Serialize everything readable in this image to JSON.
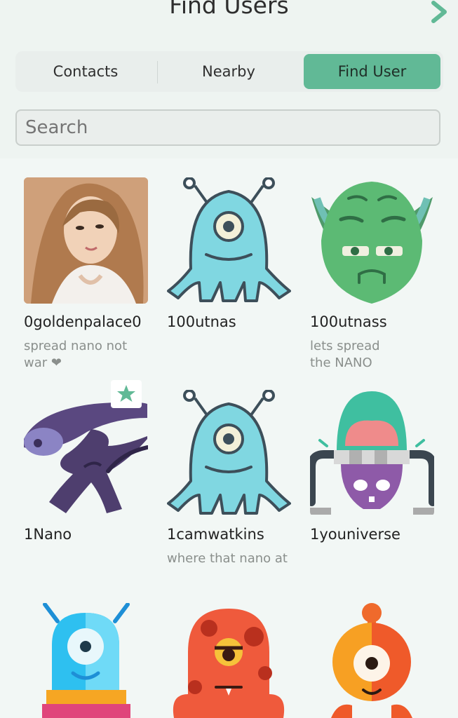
{
  "header": {
    "title": "Find Users"
  },
  "tabs": [
    {
      "label": "Contacts",
      "active": false
    },
    {
      "label": "Nearby",
      "active": false
    },
    {
      "label": "Find User",
      "active": true
    }
  ],
  "search": {
    "placeholder": "Search",
    "value": ""
  },
  "users": [
    {
      "username": "0goldenpalace0",
      "bio_line1": "spread nano not",
      "bio_line2": "war ❤",
      "avatar": "photo"
    },
    {
      "username": "100utnas",
      "bio_line1": "",
      "bio_line2": "",
      "avatar": "blue-octopus-alien-icon"
    },
    {
      "username": "100utnass",
      "bio_line1": "lets spread",
      "bio_line2": "the NANO",
      "avatar": "green-yoda-icon"
    },
    {
      "username": "1Nano",
      "bio_line1": "",
      "bio_line2": "",
      "avatar": "purple-xenomorph-icon",
      "starred": true
    },
    {
      "username": "1camwatkins",
      "bio_line1": "where that nano at",
      "bio_line2": "",
      "avatar": "blue-octopus-alien-icon"
    },
    {
      "username": "1youniverse",
      "bio_line1": "",
      "bio_line2": "",
      "avatar": "brain-dome-alien-icon"
    },
    {
      "username": "",
      "bio_line1": "",
      "bio_line2": "",
      "avatar": "cyan-robot-icon"
    },
    {
      "username": "",
      "bio_line1": "",
      "bio_line2": "",
      "avatar": "red-blob-monster-icon"
    },
    {
      "username": "",
      "bio_line1": "",
      "bio_line2": "",
      "avatar": "orange-cyclops-icon"
    }
  ],
  "colors": {
    "accent": "#61b996",
    "background": "#f2f7f5",
    "muted_text": "#8a8f8c"
  }
}
